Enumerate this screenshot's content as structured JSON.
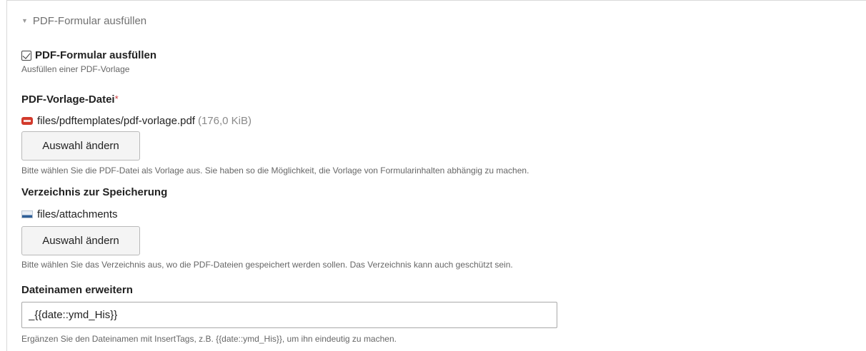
{
  "fieldset": {
    "legend": "PDF-Formular ausfüllen"
  },
  "checkbox": {
    "label": "PDF-Formular ausfüllen",
    "checked": true,
    "help": "Ausfüllen einer PDF-Vorlage"
  },
  "template_file": {
    "label": "PDF-Vorlage-Datei",
    "required_marker": "*",
    "path": "files/pdftemplates/pdf-vorlage.pdf",
    "size": "(176,0 KiB)",
    "file_icon": "pdf-icon",
    "button_label": "Auswahl ändern",
    "help": "Bitte wählen Sie die PDF-Datei als Vorlage aus. Sie haben so die Möglichkeit, die Vorlage von Formularinhalten abhängig zu machen."
  },
  "storage_dir": {
    "label": "Verzeichnis zur Speicherung",
    "path": "files/attachments",
    "folder_icon": "folder-icon",
    "button_label": "Auswahl ändern",
    "help": "Bitte wählen Sie das Verzeichnis aus, wo die PDF-Dateien gespeichert werden sollen. Das Verzeichnis kann auch geschützt sein."
  },
  "filename_extension": {
    "label": "Dateinamen erweitern",
    "value": "_{{date::ymd_His}}",
    "help": "Ergänzen Sie den Dateinamen mit InsertTags, z.B. {{date::ymd_His}}, um ihn eindeutig zu machen."
  },
  "colors": {
    "required": "#cc3333",
    "pdf_icon": "#d23a2c",
    "folder_icon": "#2e5f97"
  }
}
